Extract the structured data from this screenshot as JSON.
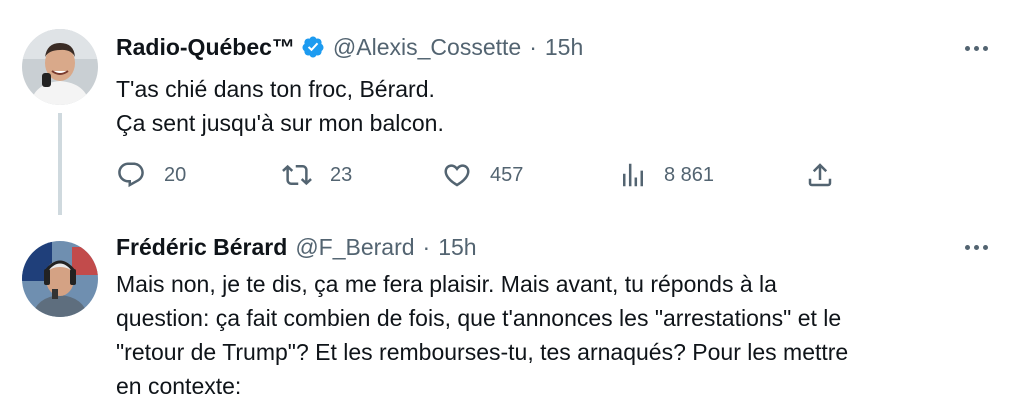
{
  "tweets": [
    {
      "name": "Radio-Québec™",
      "handle": "@Alexis_Cossette",
      "separator": "·",
      "time": "15h",
      "verified": true,
      "lines": [
        "T'as chié dans ton froc, Bérard.",
        "Ça sent jusqu'à sur mon balcon."
      ],
      "actions": {
        "replies": "20",
        "retweets": "23",
        "likes": "457",
        "views": "8 861"
      }
    },
    {
      "name": "Frédéric Bérard",
      "handle": "@F_Berard",
      "separator": "·",
      "time": "15h",
      "verified": false,
      "lines": [
        "Mais non, je te dis, ça me fera plaisir. Mais avant, tu réponds à la",
        "question: ça fait combien de fois, que t'annonces les \"arrestations\" et le",
        "\"retour de Trump\"? Et les rembourses-tu, tes arnaqués? Pour les mettre",
        "en contexte:"
      ]
    }
  ],
  "icons": {
    "verified": "verified-badge-icon",
    "more": "more-horizontal-icon",
    "reply": "reply-icon",
    "retweet": "retweet-icon",
    "like": "heart-icon",
    "views": "views-chart-icon",
    "share": "share-icon"
  },
  "colors": {
    "text": "#0f1419",
    "secondary": "#536471",
    "verified": "#1d9bf0",
    "thread_line": "#cfd9de"
  }
}
